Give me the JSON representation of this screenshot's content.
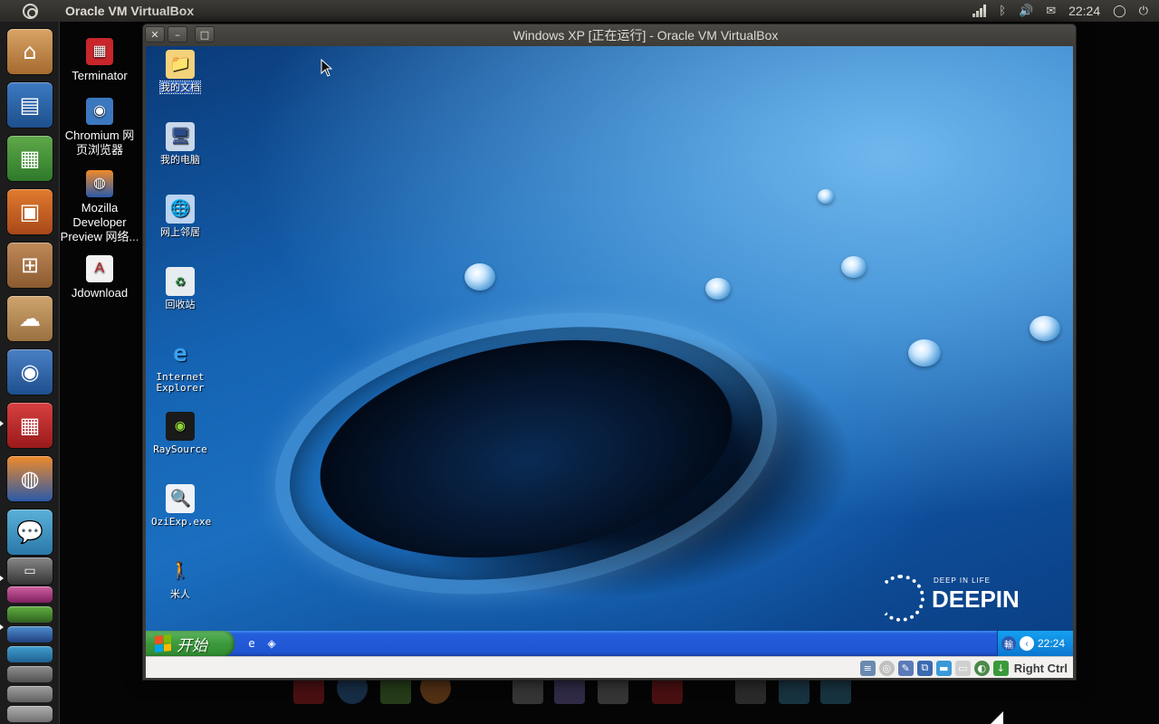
{
  "top_panel": {
    "app_title": "Oracle VM VirtualBox",
    "clock": "22:24",
    "indicators": [
      "signal-icon",
      "bluetooth-icon",
      "volume-icon",
      "mail-icon",
      "session-icon"
    ]
  },
  "launcher": {
    "items": [
      "Home Folder",
      "LibreOffice Writer",
      "LibreOffice Calc",
      "LibreOffice Impress",
      "Ubuntu Software Center",
      "Ubuntu One",
      "Chromium",
      "Terminator",
      "Firefox",
      "Empathy"
    ]
  },
  "ubuntu_desktop": {
    "icons": [
      {
        "label": "Terminator"
      },
      {
        "label": "Chromium 网页浏览器"
      },
      {
        "label": "Mozilla Developer Preview 网络..."
      },
      {
        "label": "Jdownload"
      }
    ]
  },
  "vbox_window": {
    "title": "Windows XP [正在运行] - Oracle VM VirtualBox",
    "buttons": {
      "close": "✕",
      "minimize": "–",
      "maximize": "□"
    }
  },
  "xp_desktop": {
    "icons": [
      {
        "label": "我的文档"
      },
      {
        "label": "我的电脑"
      },
      {
        "label": "网上邻居"
      },
      {
        "label": "回收站"
      },
      {
        "label": "Internet Explorer"
      },
      {
        "label": "RaySource"
      },
      {
        "label": "OziExp.exe"
      },
      {
        "label": "米人"
      }
    ],
    "branding": {
      "tag": "DEEP IN LIFE",
      "name": "DEEPIN"
    }
  },
  "xp_taskbar": {
    "start_label": "开始",
    "clock": "22:24"
  },
  "vbox_status": {
    "host_key": "Right Ctrl"
  },
  "colors": {
    "panel": "#3c3b37",
    "xp_taskbar": "#245edb",
    "xp_start": "#3c9a3c",
    "launcher_bg": "#1c1c1c"
  }
}
